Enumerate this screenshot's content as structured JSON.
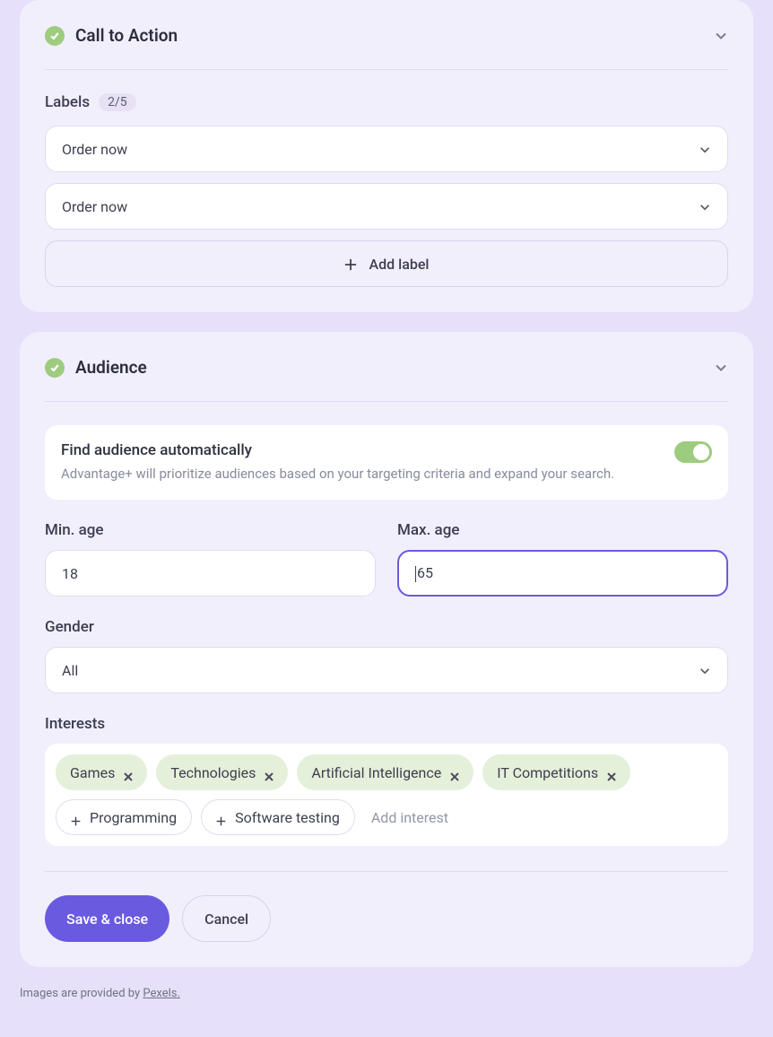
{
  "cta": {
    "title": "Call to Action",
    "labels_header": "Labels",
    "labels_count": "2/5",
    "label_dropdowns": [
      "Order now",
      "Order now"
    ],
    "add_label": "Add label"
  },
  "audience": {
    "title": "Audience",
    "auto_find": {
      "title": "Find audience automatically",
      "subtitle": "Advantage+ will prioritize audiences based on your targeting criteria and expand your search.",
      "enabled": true
    },
    "min_age_label": "Min. age",
    "min_age_value": "18",
    "max_age_label": "Max. age",
    "max_age_value": "65",
    "gender_label": "Gender",
    "gender_value": "All",
    "interests_label": "Interests",
    "interests_selected": [
      "Games",
      "Technologies",
      "Artificial Intelligence",
      "IT Competitions"
    ],
    "interests_suggested": [
      "Programming",
      "Software testing"
    ],
    "add_interest_placeholder": "Add interest"
  },
  "actions": {
    "save": "Save & close",
    "cancel": "Cancel"
  },
  "footer": {
    "prefix": "Images are provided by ",
    "link": "Pexels."
  }
}
